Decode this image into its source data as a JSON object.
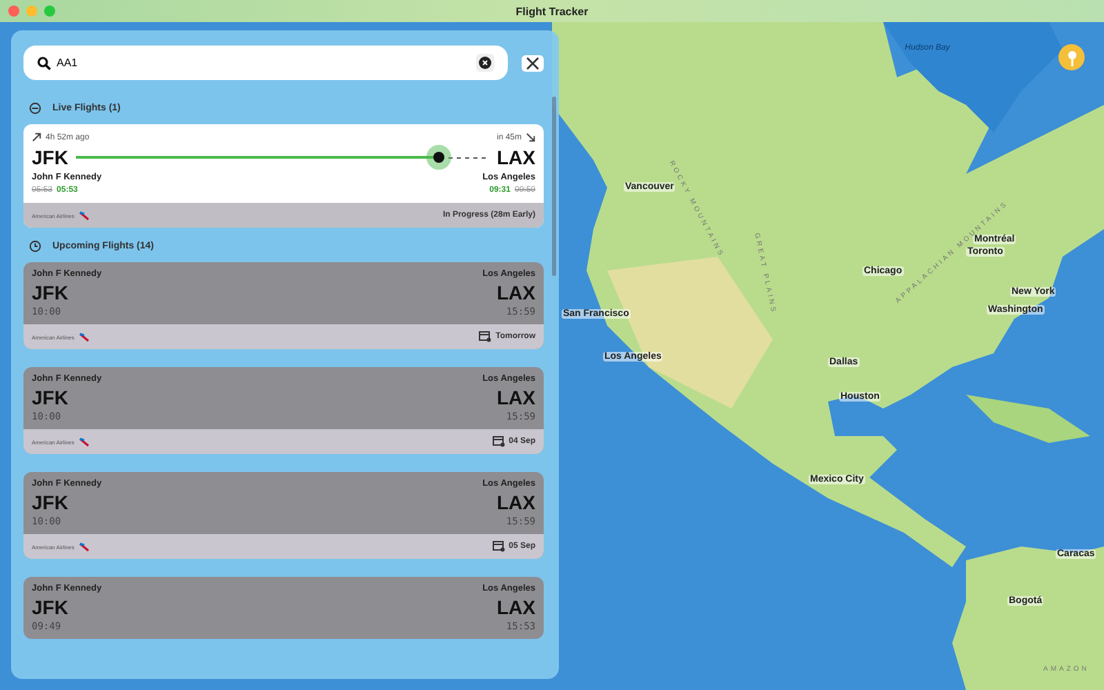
{
  "window": {
    "title": "Flight Tracker"
  },
  "search": {
    "value": "AA1"
  },
  "live_section": {
    "title": "Live Flights (1)"
  },
  "live_flights": [
    {
      "departed": "4h 52m ago",
      "arrives": "in 45m",
      "from_code": "JFK",
      "to_code": "LAX",
      "from_name": "John F Kennedy",
      "to_name": "Los Angeles",
      "dep_scheduled": "05:53",
      "dep_actual": "05:53",
      "arr_actual": "09:31",
      "arr_scheduled": "09:59",
      "level": 0.88,
      "airline": "American Airlines",
      "status": "In Progress (28m Early)"
    }
  ],
  "upcoming_section": {
    "title": "Upcoming Flights (14)"
  },
  "upcoming_flights": [
    {
      "from_name": "John F Kennedy",
      "to_name": "Los Angeles",
      "from_code": "JFK",
      "to_code": "LAX",
      "dep": "10:00",
      "arr": "15:59",
      "airline": "American Airlines",
      "date": "Tomorrow"
    },
    {
      "from_name": "John F Kennedy",
      "to_name": "Los Angeles",
      "from_code": "JFK",
      "to_code": "LAX",
      "dep": "10:00",
      "arr": "15:59",
      "airline": "American Airlines",
      "date": "04 Sep"
    },
    {
      "from_name": "John F Kennedy",
      "to_name": "Los Angeles",
      "from_code": "JFK",
      "to_code": "LAX",
      "dep": "10:00",
      "arr": "15:59",
      "airline": "American Airlines",
      "date": "05 Sep"
    },
    {
      "from_name": "John F Kennedy",
      "to_name": "Los Angeles",
      "from_code": "JFK",
      "to_code": "LAX",
      "dep": "09:49",
      "arr": "15:53"
    }
  ],
  "map": {
    "labels": [
      {
        "text": "Hudson Bay",
        "kind": "water"
      },
      {
        "text": "ROCKY MOUNTAINS",
        "kind": "range"
      },
      {
        "text": "Vancouver",
        "kind": "city"
      },
      {
        "text": "GREAT PLAINS",
        "kind": "range"
      },
      {
        "text": "Montréal",
        "kind": "city"
      },
      {
        "text": "Toronto",
        "kind": "city"
      },
      {
        "text": "Chicago",
        "kind": "city"
      },
      {
        "text": "APPALACHIAN MOUNTAINS",
        "kind": "range"
      },
      {
        "text": "New York",
        "kind": "city"
      },
      {
        "text": "San Francisco",
        "kind": "city"
      },
      {
        "text": "Washington",
        "kind": "city"
      },
      {
        "text": "Los Angeles",
        "kind": "city"
      },
      {
        "text": "Dallas",
        "kind": "city"
      },
      {
        "text": "Houston",
        "kind": "city"
      },
      {
        "text": "Mexico City",
        "kind": "city"
      },
      {
        "text": "Caracas",
        "kind": "city"
      },
      {
        "text": "Bogotá",
        "kind": "city"
      },
      {
        "text": "AMAZON",
        "kind": "range"
      }
    ]
  }
}
